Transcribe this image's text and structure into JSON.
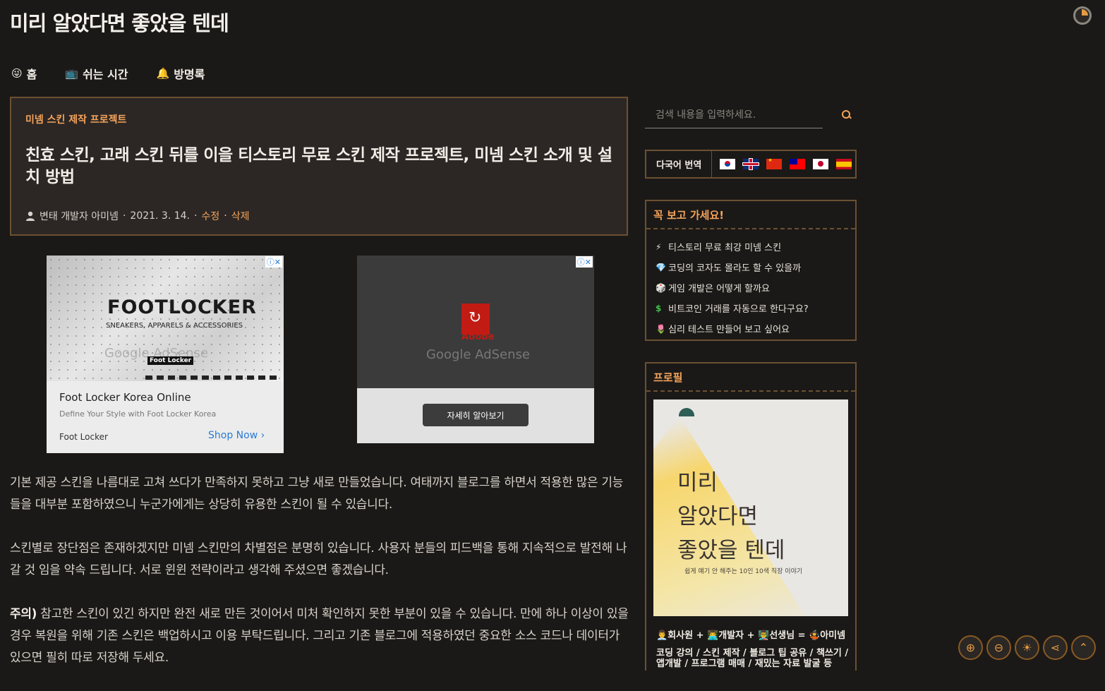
{
  "blog": {
    "title": "미리 알았다면 좋았을 텐데"
  },
  "nav": {
    "items": [
      {
        "icon": "😜",
        "label": "홈"
      },
      {
        "icon": "📺",
        "label": "쉬는 시간"
      },
      {
        "icon": "🔔",
        "label": "방명록"
      }
    ]
  },
  "article": {
    "category": "미넴 스킨 제작 프로젝트",
    "title": "친효 스킨, 고래 스킨 뒤를 이을 티스토리 무료 스킨 제작 프로젝트, 미넴 스킨 소개 및 설치 방법",
    "author": "변태 개발자 아미넴",
    "date": "2021. 3. 14.",
    "edit_label": "수정",
    "delete_label": "삭제",
    "sep": "·",
    "paragraphs": [
      "기본 제공 스킨을 나름대로 고쳐 쓰다가 만족하지 못하고 그냥 새로 만들었습니다. 여태까지 블로그를 하면서 적용한 많은 기능들을 대부분 포함하였으니 누군가에게는 상당히 유용한 스킨이 될 수 있습니다.",
      "스킨별로 장단점은 존재하겠지만 미넴 스킨만의 차별점은 분명히 있습니다. 사용자 분들의 피드백을 통해 지속적으로 발전해 나갈 것 임을 약속 드립니다. 서로 윈윈 전략이라고 생각해 주셨으면 좋겠습니다."
    ],
    "warning_label": "주의)",
    "warning_text": " 참고한 스킨이 있긴 하지만 완전 새로 만든 것이어서 미처 확인하지 못한 부분이 있을 수 있습니다. 만에 하나 이상이 있을 경우 복원을 위해 기존 스킨은 백업하시고 이용 부탁드립니다. 그리고 기존 블로그에 적용하였던 중요한 소스 코드나 데이터가 있으면 필히 따로 저장해 두세요."
  },
  "ads": {
    "ad1": {
      "brand": "FOOTLOCKER",
      "tagline": "SNEAKERS, APPARELS & ACCESSORIES",
      "watermark": "Google AdSense",
      "badge": "Foot Locker",
      "headline": "Foot Locker Korea Online",
      "description": "Define Your Style with Foot Locker Korea",
      "advertiser": "Foot Locker",
      "cta": "Shop Now",
      "choices": "ⓘ✕"
    },
    "ad2": {
      "brand": "Adobe",
      "watermark": "Google AdSense",
      "cta": "자세히 알아보기",
      "choices": "ⓘ✕"
    }
  },
  "sidebar": {
    "search": {
      "placeholder": "검색 내용을 입력하세요."
    },
    "translate": {
      "label": "다국어 번역",
      "flags": [
        "korean",
        "english",
        "chinese",
        "taiwanese",
        "japanese",
        "spanish"
      ]
    },
    "must_see": {
      "title": "꼭 보고 가세요!",
      "items": [
        {
          "icon": "⚡",
          "label": "티스토리 무료 최강 미넴 스킨"
        },
        {
          "icon": "💎",
          "label": "코딩의 코자도 몰라도 할 수 있을까"
        },
        {
          "icon": "🎲",
          "label": "게임 개발은 어떻게 할까요"
        },
        {
          "icon": "$",
          "label": "비트코인 거래를 자동으로 한다구요?"
        },
        {
          "icon": "🌷",
          "label": "심리 테스트 만들어 보고 싶어요"
        }
      ]
    },
    "profile": {
      "title": "프로필",
      "image_text": [
        "미리",
        "알았다면",
        "좋았을 텐데"
      ],
      "image_sub": "쉽게 얘기 안 해주는 10인 10색 직장 이야기",
      "line1": "👨‍💼회사원 + 👨‍💻개발자 + 👨‍🏫선생님 = 🤹아미넴",
      "line2": "코딩 강의 / 스킨 제작 / 블로그 팁 공유 / 책쓰기 / 앱개발 / 프로그램 매매 / 재밌는 자료 발굴 등"
    }
  },
  "colors": {
    "accent": "#f4a35b",
    "background": "#1b1917",
    "panel": "#2c2725",
    "border": "#6b5032"
  },
  "fab": {
    "icons": [
      "zoom-in-icon",
      "zoom-out-icon",
      "sun-icon",
      "share-icon",
      "scroll-top-icon"
    ],
    "glyphs": [
      "⊕",
      "⊖",
      "☀",
      "⋖",
      "⌃"
    ]
  }
}
